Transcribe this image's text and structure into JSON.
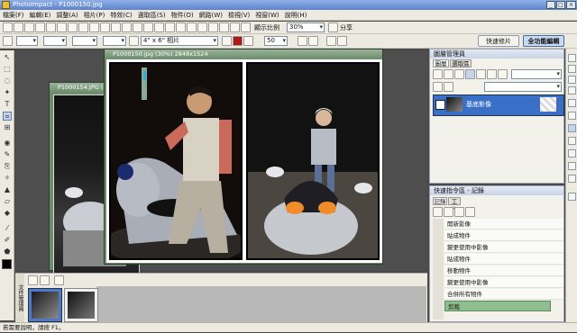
{
  "window": {
    "title": "PhotoImpact - P1000150.jpg"
  },
  "menu": [
    "檔案(F)",
    "編輯(E)",
    "調整(A)",
    "相片(P)",
    "特效(C)",
    "選取區(S)",
    "物件(O)",
    "網路(W)",
    "檢視(V)",
    "視窗(W)",
    "說明(H)"
  ],
  "toolbar1": {
    "zoom_label": "顯示比例",
    "zoom_value": "30%",
    "share_label": "分享"
  },
  "toolbar2": {
    "size_value": "4\" x 6\" 相片",
    "opacity_value": "50"
  },
  "mode_buttons": {
    "quick": "快速修片",
    "full": "全功能編輯"
  },
  "documents": {
    "front": {
      "title": "P1000150.jpg (30%) 2848x1524"
    },
    "back": {
      "title": "P1000154.JPG (3"
    }
  },
  "layer_manager": {
    "title": "圖層管理員",
    "tabs": [
      "圖層",
      "選取區"
    ],
    "layer_name": "基底影像"
  },
  "quick_command": {
    "title": "快速指令區 - 記錄",
    "tabs": [
      "記錄",
      "工作"
    ],
    "items": [
      "開新影像",
      "貼成物件",
      "變更使用中影像",
      "貼成物件",
      "移動物件",
      "變更使用中影像",
      "合併所有物件",
      "剪裁"
    ]
  },
  "filmstrip": {
    "side_label": "文件管理員"
  },
  "status": {
    "text": "若需要說明，請按 F1。"
  }
}
